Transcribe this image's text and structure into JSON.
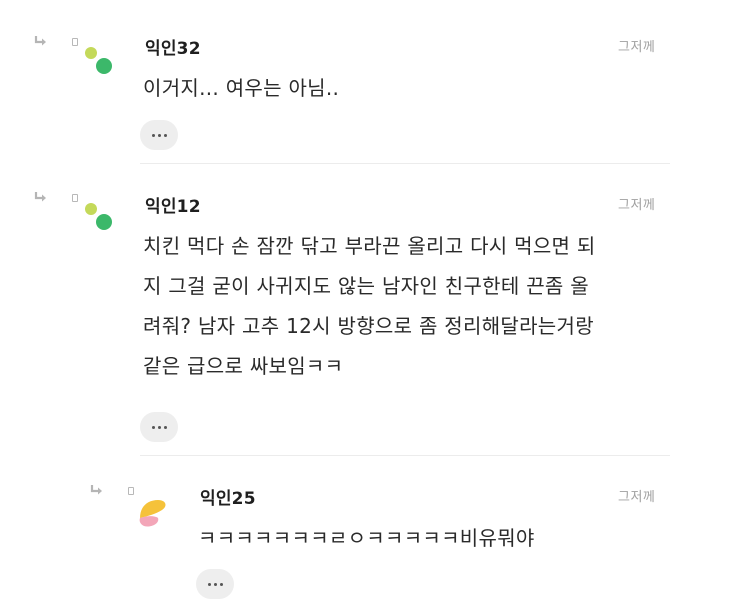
{
  "comments": [
    {
      "author": "익인32",
      "time": "그저께",
      "lines": [
        "이거지... 여우는 아님.."
      ],
      "avatar_icon": "green-dots-avatar-icon",
      "colors": {
        "dot_small": "#c4d95a",
        "dot_large": "#3cb86a"
      }
    },
    {
      "author": "익인12",
      "time": "그저께",
      "lines": [
        "치킨 먹다 손 잠깐 닦고 부라끈 올리고 다시 먹으면 되",
        "지 그걸 굳이 사귀지도 않는 남자인 친구한테 끈좀 올",
        "려줘? 남자 고추 12시 방향으로 좀 정리해달라는거랑",
        "같은 급으로 싸보임ㅋㅋ"
      ],
      "avatar_icon": "green-dots-avatar-icon",
      "colors": {
        "dot_small": "#c4d95a",
        "dot_large": "#3cb86a"
      }
    },
    {
      "author": "익인25",
      "time": "그저께",
      "lines": [
        "ㅋㅋㅋㅋㅋㅋㅋㄹㅇㅋㅋㅋㅋㅋ비유뭐야"
      ],
      "avatar_icon": "yellow-pink-avatar-icon",
      "colors": {
        "top": "#f5c23a",
        "bottom": "#f3a6b8"
      }
    }
  ],
  "icons": {
    "reply": "reply-arrow-icon",
    "more": "more-options-icon"
  }
}
